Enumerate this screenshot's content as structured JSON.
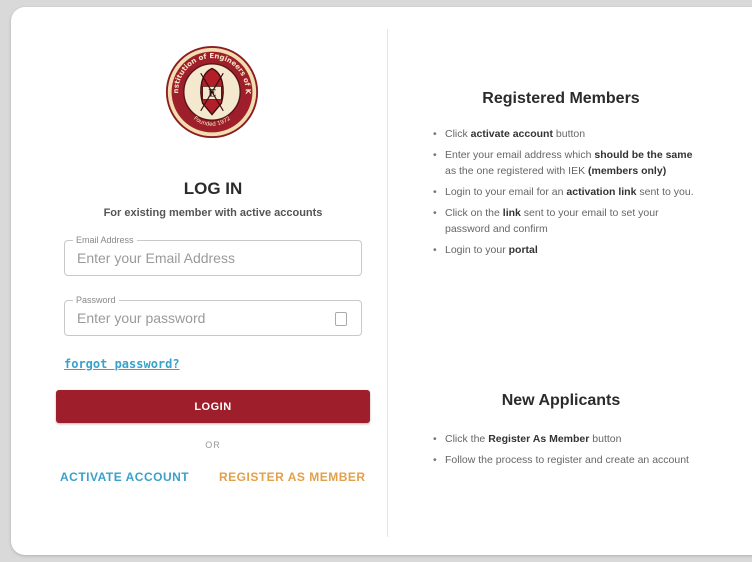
{
  "login": {
    "title": "LOG IN",
    "subtitle": "For existing member with active accounts",
    "email_label": "Email Address",
    "email_placeholder": "Enter your Email Address",
    "password_label": "Password",
    "password_placeholder": "Enter your password",
    "forgot_label": "forgot password?",
    "button_label": "LOGIN",
    "or_label": "OR",
    "activate_label": "ACTIVATE ACCOUNT",
    "register_label": "REGISTER AS MEMBER"
  },
  "registered": {
    "heading": "Registered Members",
    "items": [
      {
        "pre": "Click ",
        "bold": "activate account",
        "post": " button",
        "bold2": "",
        "post2": ""
      },
      {
        "pre": "Enter your email address which ",
        "bold": "should be the same",
        "post": " as the one registered with IEK ",
        "bold2": "(members only)",
        "post2": ""
      },
      {
        "pre": "Login to your email for an ",
        "bold": "activation link",
        "post": " sent to you.",
        "bold2": "",
        "post2": ""
      },
      {
        "pre": "Click on the ",
        "bold": "link",
        "post": " sent to your email to set your password and confirm",
        "bold2": "",
        "post2": ""
      },
      {
        "pre": "Login to your ",
        "bold": "portal",
        "post": "",
        "bold2": "",
        "post2": ""
      }
    ]
  },
  "applicants": {
    "heading": "New Applicants",
    "items": [
      {
        "pre": "Click the ",
        "bold": "Register As Member",
        "post": " button",
        "bold2": "",
        "post2": ""
      },
      {
        "pre": "Follow the process to register and create an account",
        "bold": "",
        "post": "",
        "bold2": "",
        "post2": ""
      }
    ]
  },
  "logo": {
    "icon": "institution-seal-icon",
    "ring_text": "The Institution of Engineers of Kenya",
    "bottom_text": "Founded 1972",
    "shield_letter": "E"
  },
  "colors": {
    "primary": "#9e1f2b",
    "link_blue": "#3aa1c9",
    "link_orange": "#e3a04a"
  }
}
